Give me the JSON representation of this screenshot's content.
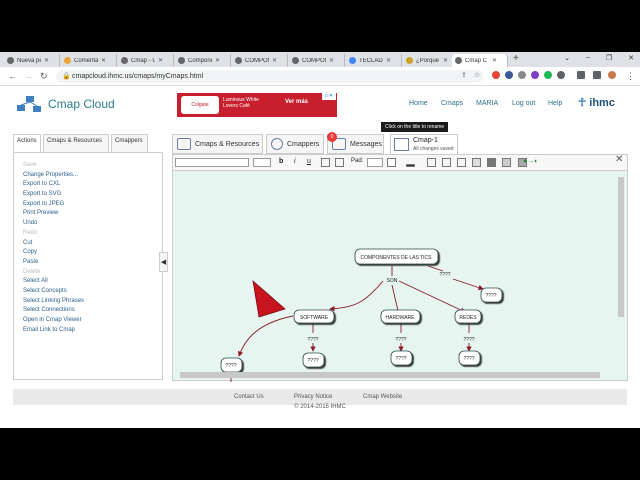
{
  "browser": {
    "tabs": [
      "Nueva pe",
      "Comenta",
      "Cmap - U",
      "Compone",
      "COMPON",
      "COMPON",
      "TECLADO",
      "¿Porque",
      "Cmap C"
    ],
    "url": "cmapcloud.ihmc.us/cmaps/myCmaps.html"
  },
  "header": {
    "app_name": "Cmap Cloud",
    "nav": [
      "Home",
      "Cmaps",
      "MARIA",
      "Log out",
      "Help"
    ],
    "org": "ihmc",
    "ad": {
      "brand": "Colgate",
      "text": "Luminous White Lovers Café",
      "cta": "Ver más"
    },
    "tooltip": "Click on the title to rename"
  },
  "left_tabs": [
    "Actions",
    "Cmaps & Resources",
    "Cmappers"
  ],
  "actions": [
    {
      "label": "Save",
      "disabled": true
    },
    {
      "label": "Change Properties...",
      "disabled": false
    },
    {
      "label": "Export to CXL",
      "disabled": false
    },
    {
      "label": "Export to SVG",
      "disabled": false
    },
    {
      "label": "Export to JPEG",
      "disabled": false
    },
    {
      "label": "Print Preview",
      "disabled": false
    },
    {
      "label": "Undo",
      "disabled": false
    },
    {
      "label": "Redo",
      "disabled": true
    },
    {
      "label": "Cut",
      "disabled": false
    },
    {
      "label": "Copy",
      "disabled": false
    },
    {
      "label": "Paste",
      "disabled": false
    },
    {
      "label": "Delete",
      "disabled": true
    },
    {
      "label": "Select All",
      "disabled": false
    },
    {
      "label": "Select Concepts",
      "disabled": false
    },
    {
      "label": "Select Linking Phrases",
      "disabled": false
    },
    {
      "label": "Select Connections",
      "disabled": false
    },
    {
      "label": "Open in Cmap Viewer",
      "disabled": false
    },
    {
      "label": "Email Link to Cmap",
      "disabled": false
    }
  ],
  "right_tabs": {
    "resources": "Cmaps & Resources",
    "cmappers": "Cmappers",
    "messages": "Messages",
    "messages_count": "0"
  },
  "cmap_tab": {
    "name": "Cmap-1",
    "status": "All changes saved"
  },
  "toolbar": {
    "pad_label": "Pad:"
  },
  "concept_map": {
    "concepts": [
      "COMPONENTES DE LAS TICS",
      "SOFTWARE",
      "HARDWARE",
      "REDES",
      "????",
      "????",
      "????",
      "????",
      "????"
    ],
    "linking_phrases": [
      "SON",
      "????",
      "????",
      "????",
      "????"
    ]
  },
  "footer": {
    "links": [
      "Contact Us",
      "Privacy Notice",
      "Cmap Website"
    ],
    "copyright": "© 2014-2015 IHMC"
  }
}
